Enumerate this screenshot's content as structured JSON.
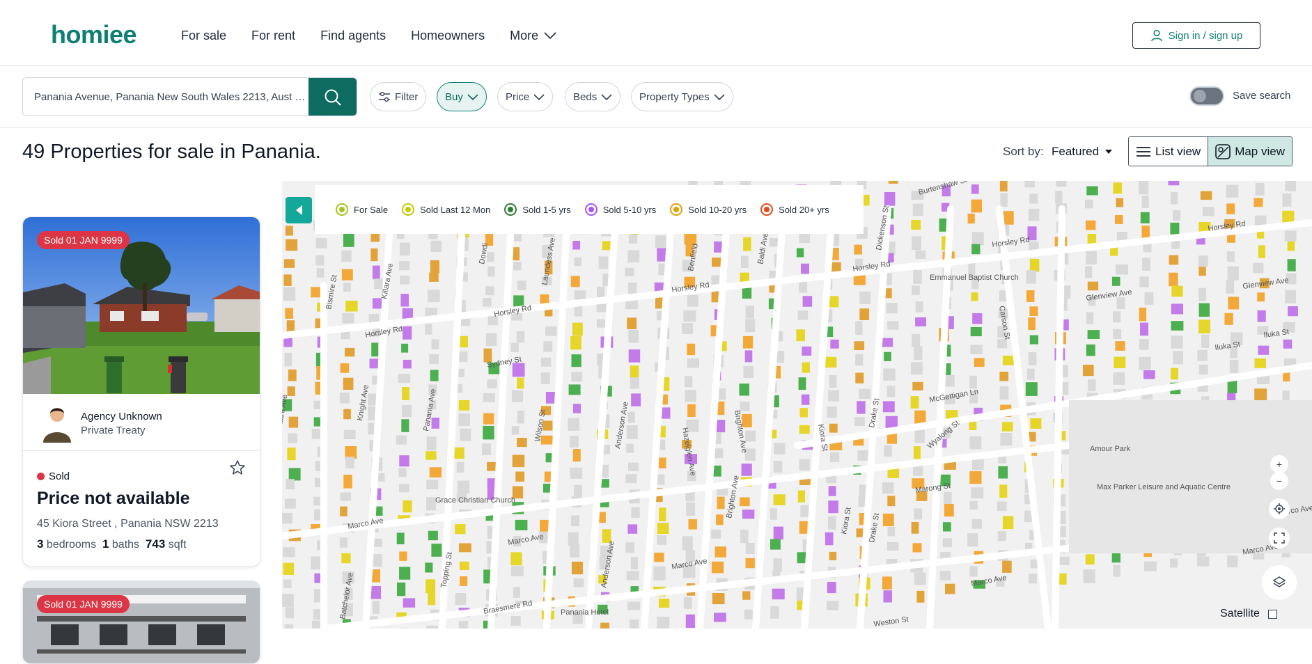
{
  "header": {
    "logo": "homiee",
    "nav": [
      "For sale",
      "For rent",
      "Find agents",
      "Homeowners",
      "More"
    ],
    "signin_label": "Sign in / sign up"
  },
  "search": {
    "value": "Panania Avenue, Panania New South Wales 2213, Aust …",
    "chips": {
      "filter": "Filter",
      "buy": "Buy",
      "price": "Price",
      "beds": "Beds",
      "property_types": "Property Types"
    },
    "save_search_label": "Save search",
    "save_search_on": false
  },
  "results": {
    "title": "49 Properties for sale in Panania.",
    "sort_label": "Sort by:",
    "sort_value": "Featured",
    "list_view_label": "List view",
    "map_view_label": "Map view",
    "active_view": "Map view"
  },
  "listings": [
    {
      "badge": "Sold 01 JAN 9999",
      "agent_name": "Agency Unknown",
      "agent_type": "Private Treaty",
      "status": "Sold",
      "price": "Price not available",
      "address": "45 Kiora Street , Panania NSW 2213",
      "bedrooms": "3",
      "bedrooms_label": "bedrooms",
      "baths": "1",
      "baths_label": "baths",
      "area": "743",
      "area_label": "sqft"
    },
    {
      "badge": "Sold 01 JAN 9999"
    }
  ],
  "map": {
    "legend": [
      {
        "label": "For Sale",
        "color": "#a3c41c"
      },
      {
        "label": "Sold Last 12 Mon",
        "color": "#c9c900"
      },
      {
        "label": "Sold 1-5 yrs",
        "color": "#2e7d32"
      },
      {
        "label": "Sold 5-10 yrs",
        "color": "#a855f7"
      },
      {
        "label": "Sold 10-20 yrs",
        "color": "#e5a000"
      },
      {
        "label": "Sold 20+ yrs",
        "color": "#e24a1a"
      }
    ],
    "street_labels": [
      "Burtenshaw St",
      "Horsley Rd",
      "Horsley Rd",
      "Horsley Rd",
      "Horsley Rd",
      "Horsley Rd",
      "Horsley Rd",
      "Dickenson St",
      "Baldi Ave",
      "Benfield",
      "Laundess Ave",
      "Dowdi",
      "Killara Ave",
      "Bismire St",
      "Emmanuel Baptist Church",
      "Carson St",
      "Glenview Ave",
      "Glenview Ave",
      "Iluka St",
      "Iluka St",
      "Sydney St",
      "Knight Ave",
      "Panania Ave",
      "Wilson St",
      "Anderson Ave",
      "Hazelglen Ave",
      "Brighton Ave",
      "Kiora St",
      "Drake St",
      "McGettigan Ln",
      "Wyalong St",
      "Amour Park",
      "Max Parker Leisure and Aquatic Centre",
      "Grace Christian Church",
      "Marco Ave",
      "Marco Ave",
      "Marco Ave",
      "Marco Ave",
      "Marco Ave",
      "Marong St",
      "Brighton Ave",
      "Kiora St",
      "Drake St",
      "Anderson Ave",
      "Topping St",
      "Batchelor Ave",
      "Braesmere Rd",
      "Panania Hotel",
      "Weston St",
      "Lara Ave",
      "Marco Ave"
    ],
    "satellite_label": "Satellite",
    "zoom_in": "+",
    "zoom_out": "−"
  },
  "icons": {
    "search": "search-icon",
    "filter": "sliders-icon",
    "user": "user-icon",
    "star": "star-icon",
    "list": "list-icon",
    "map": "map-icon"
  },
  "colors": {
    "brand": "#0d8073",
    "sold_badge": "#dc3545",
    "map_bg": "#f2f2f2"
  }
}
